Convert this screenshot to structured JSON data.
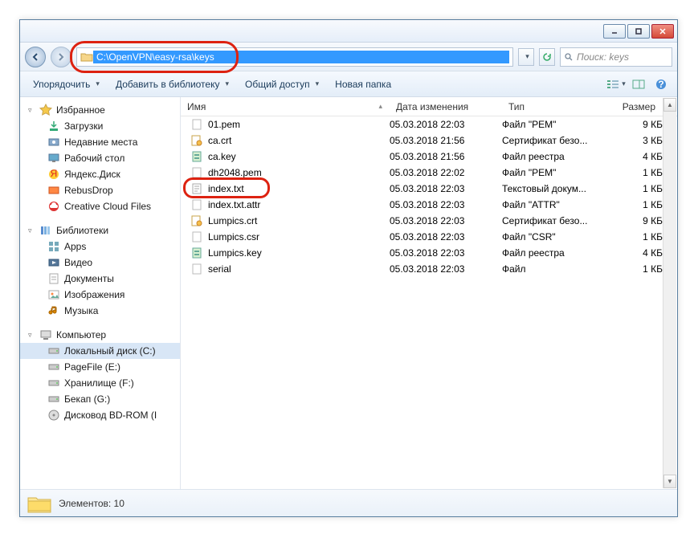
{
  "address_path": "C:\\OpenVPN\\easy-rsa\\keys",
  "search_placeholder": "Поиск: keys",
  "toolbar": {
    "organize": "Упорядочить",
    "add_library": "Добавить в библиотеку",
    "share": "Общий доступ",
    "new_folder": "Новая папка"
  },
  "columns": {
    "name": "Имя",
    "date": "Дата изменения",
    "type": "Тип",
    "size": "Размер"
  },
  "sidebar": {
    "favorites": "Избранное",
    "fav_items": [
      "Загрузки",
      "Недавние места",
      "Рабочий стол",
      "Яндекс.Диск",
      "RebusDrop",
      "Creative Cloud Files"
    ],
    "libraries": "Библиотеки",
    "lib_items": [
      "Apps",
      "Видео",
      "Документы",
      "Изображения",
      "Музыка"
    ],
    "computer": "Компьютер",
    "comp_items": [
      "Локальный диск (C:)",
      "PageFile (E:)",
      "Хранилище (F:)",
      "Бекап (G:)",
      "Дисковод BD-ROM (I"
    ]
  },
  "files": [
    {
      "name": "01.pem",
      "date": "05.03.2018 22:03",
      "type": "Файл \"PEM\"",
      "size": "9 КБ",
      "icon": "file"
    },
    {
      "name": "ca.crt",
      "date": "05.03.2018 21:56",
      "type": "Сертификат безо...",
      "size": "3 КБ",
      "icon": "cert"
    },
    {
      "name": "ca.key",
      "date": "05.03.2018 21:56",
      "type": "Файл реестра",
      "size": "4 КБ",
      "icon": "reg"
    },
    {
      "name": "dh2048.pem",
      "date": "05.03.2018 22:02",
      "type": "Файл \"PEM\"",
      "size": "1 КБ",
      "icon": "file"
    },
    {
      "name": "index.txt",
      "date": "05.03.2018 22:03",
      "type": "Текстовый докум...",
      "size": "1 КБ",
      "icon": "txt",
      "highlight": true
    },
    {
      "name": "index.txt.attr",
      "date": "05.03.2018 22:03",
      "type": "Файл \"ATTR\"",
      "size": "1 КБ",
      "icon": "file"
    },
    {
      "name": "Lumpics.crt",
      "date": "05.03.2018 22:03",
      "type": "Сертификат безо...",
      "size": "9 КБ",
      "icon": "cert"
    },
    {
      "name": "Lumpics.csr",
      "date": "05.03.2018 22:03",
      "type": "Файл \"CSR\"",
      "size": "1 КБ",
      "icon": "file"
    },
    {
      "name": "Lumpics.key",
      "date": "05.03.2018 22:03",
      "type": "Файл реестра",
      "size": "4 КБ",
      "icon": "reg"
    },
    {
      "name": "serial",
      "date": "05.03.2018 22:03",
      "type": "Файл",
      "size": "1 КБ",
      "icon": "file"
    }
  ],
  "status": {
    "label": "Элементов: 10"
  }
}
